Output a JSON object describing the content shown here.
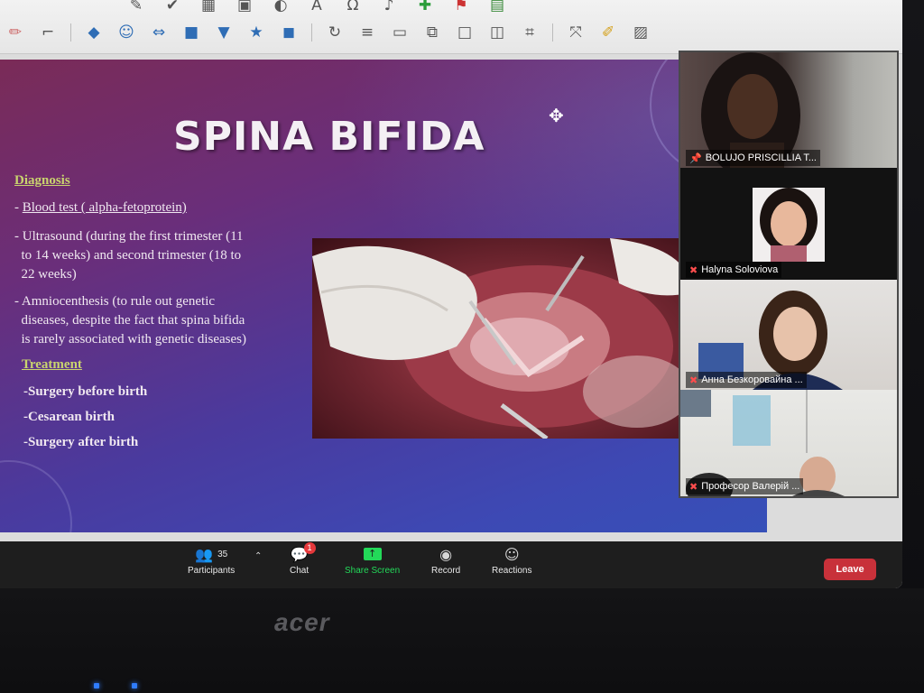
{
  "slide": {
    "title": "SPINA BIFIDA",
    "diagnosis_heading": "Diagnosis",
    "bullet_1": "Blood test ( alpha-fetoprotein)",
    "bullet_2_l1": "Ultrasound (during the first trimester (11",
    "bullet_2_l2": "to 14 weeks) and second trimester (18 to",
    "bullet_2_l3": "22 weeks)",
    "bullet_3_l1": "Amniocenthesis (to rule out genetic",
    "bullet_3_l2": "diseases, despite the fact that spina bifida",
    "bullet_3_l3": "is rarely associated with genetic diseases)",
    "treatment_heading": "Treatment",
    "treatment_1": "-Surgery before birth",
    "treatment_2": "-Cesarean birth",
    "treatment_3": "-Surgery after birth"
  },
  "participants_videos": [
    {
      "name": "BOLUJO PRISCILLIA T...",
      "mic_icon": "pin-icon"
    },
    {
      "name": "Halyna Soloviova",
      "mic_icon": "mic-muted-icon"
    },
    {
      "name": "Анна Безкоровайна ...",
      "mic_icon": "mic-muted-icon"
    },
    {
      "name": "Професор  Валерій ...",
      "mic_icon": "mic-muted-icon"
    }
  ],
  "zoom_controls": {
    "participants_label": "Participants",
    "participants_count": "35",
    "chat_label": "Chat",
    "chat_badge": "1",
    "share_label": "Share Screen",
    "record_label": "Record",
    "reactions_label": "Reactions",
    "leave_label": "Leave"
  },
  "laptop": {
    "brand": "acer"
  },
  "colors": {
    "share_screen_green": "#23d959",
    "leave_red": "#c8313a",
    "heading_yellow": "#c9d46e"
  }
}
